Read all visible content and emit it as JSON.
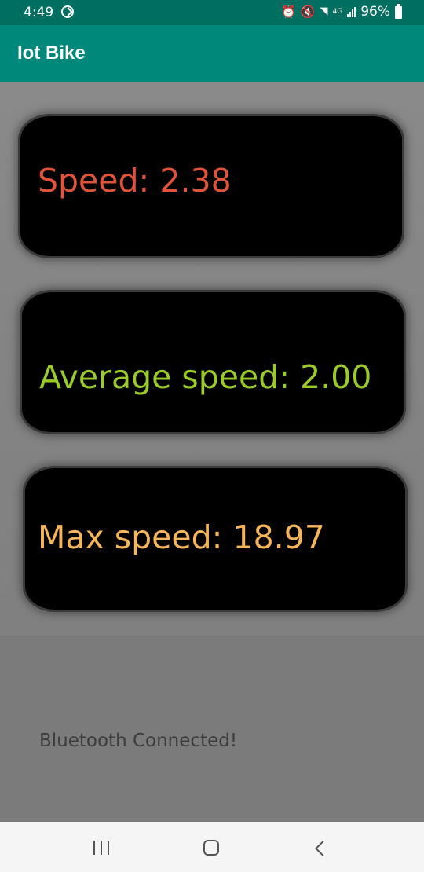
{
  "status_bar": {
    "time": "4:49",
    "network_label": "4G",
    "battery_percent": "96%",
    "icons": [
      "sync-icon",
      "alarm-icon",
      "mute-icon",
      "wifi-icon",
      "signal-icon",
      "battery-icon"
    ]
  },
  "app_bar": {
    "title": "Iot Bike",
    "color": "#00897b"
  },
  "cards": [
    {
      "text": "Speed: 2.38",
      "color": "#e0543a"
    },
    {
      "text": "Average speed: 2.00",
      "color": "#9bcb2a"
    },
    {
      "text": "Max speed: 18.97",
      "color": "#f5b55a"
    }
  ],
  "status_message": "Bluetooth Connected!",
  "nav_bar": {
    "icons": [
      "recent-apps-icon",
      "home-icon",
      "back-icon"
    ]
  }
}
